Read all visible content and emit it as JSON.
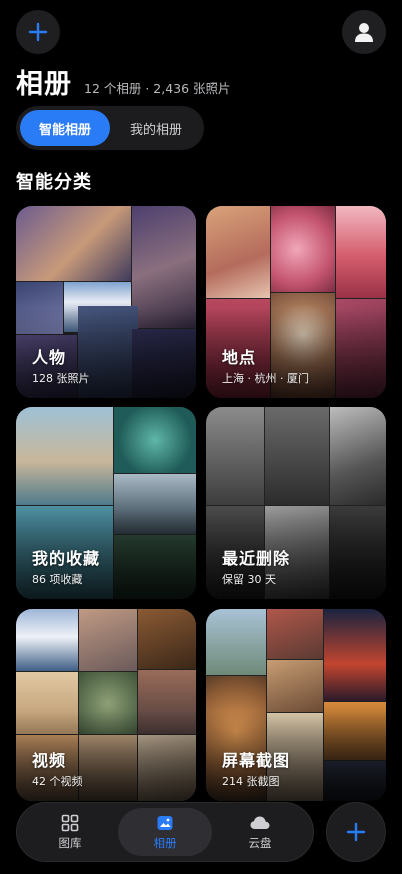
{
  "header": {
    "title": "相册",
    "subtitle": "12 个相册 · 2,436 张照片"
  },
  "segments": {
    "smart": "智能相册",
    "mine": "我的相册"
  },
  "section_title": "智能分类",
  "cards": [
    {
      "title": "人物",
      "subtitle": "128 张照片"
    },
    {
      "title": "地点",
      "subtitle": "上海 · 杭州 · 厦门"
    },
    {
      "title": "我的收藏",
      "subtitle": "86 项收藏"
    },
    {
      "title": "最近删除",
      "subtitle": "保留 30 天"
    },
    {
      "title": "视频",
      "subtitle": "42 个视频"
    },
    {
      "title": "屏幕截图",
      "subtitle": "214 张截图"
    }
  ],
  "tabs": {
    "gallery": "图库",
    "albums": "相册",
    "cloud": "云盘"
  },
  "icons": {
    "add_top": "plus-icon",
    "avatar": "user-icon",
    "gallery": "grid-icon",
    "albums": "album-icon",
    "cloud": "cloud-icon",
    "add_bottom": "plus-icon"
  },
  "colors": {
    "accent": "#2a7bf6",
    "background": "#000000",
    "surface": "#1d1d20"
  }
}
